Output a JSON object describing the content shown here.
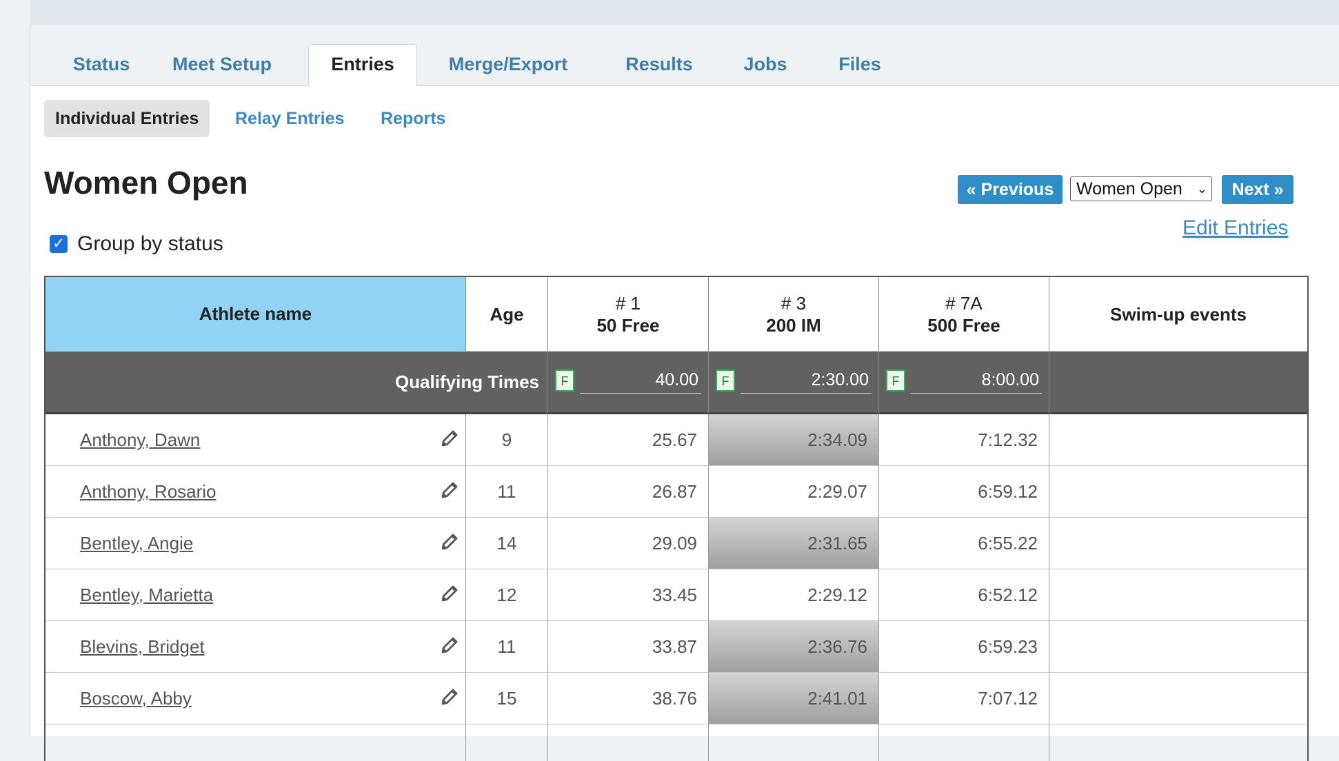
{
  "tabs": [
    {
      "label": "Status"
    },
    {
      "label": "Meet Setup"
    },
    {
      "label": "Entries"
    },
    {
      "label": "Merge/Export"
    },
    {
      "label": "Results"
    },
    {
      "label": "Jobs"
    },
    {
      "label": "Files"
    }
  ],
  "subtabs": [
    {
      "label": "Individual Entries"
    },
    {
      "label": "Relay Entries"
    },
    {
      "label": "Reports"
    }
  ],
  "page": {
    "title": "Women Open",
    "prev_label": "« Previous",
    "next_label": "Next »",
    "select_value": "Women Open",
    "edit_entries": "Edit Entries",
    "group_by_status": "Group by status"
  },
  "table": {
    "headers": {
      "athlete": "Athlete name",
      "age": "Age",
      "e1_num": "# 1",
      "e1_name": "50 Free",
      "e3_num": "# 3",
      "e3_name": "200 IM",
      "e7_num": "# 7A",
      "e7_name": "500 Free",
      "swimup": "Swim-up events"
    },
    "qualifying": {
      "label": "Qualifying Times",
      "badge": "F",
      "e1": "40.00",
      "e3": "2:30.00",
      "e7": "8:00.00"
    },
    "rows": [
      {
        "name": "Anthony, Dawn",
        "age": "9",
        "e1": "25.67",
        "e3": "2:34.09",
        "e7": "7:12.32"
      },
      {
        "name": "Anthony, Rosario",
        "age": "11",
        "e1": "26.87",
        "e3": "2:29.07",
        "e7": "6:59.12"
      },
      {
        "name": "Bentley, Angie",
        "age": "14",
        "e1": "29.09",
        "e3": "2:31.65",
        "e7": "6:55.22"
      },
      {
        "name": "Bentley, Marietta",
        "age": "12",
        "e1": "33.45",
        "e3": "2:29.12",
        "e7": "6:52.12"
      },
      {
        "name": "Blevins, Bridget",
        "age": "11",
        "e1": "33.87",
        "e3": "2:36.76",
        "e7": "6:59.23"
      },
      {
        "name": "Boscow, Abby",
        "age": "15",
        "e1": "38.76",
        "e3": "2:41.01",
        "e7": "7:07.12"
      }
    ]
  }
}
